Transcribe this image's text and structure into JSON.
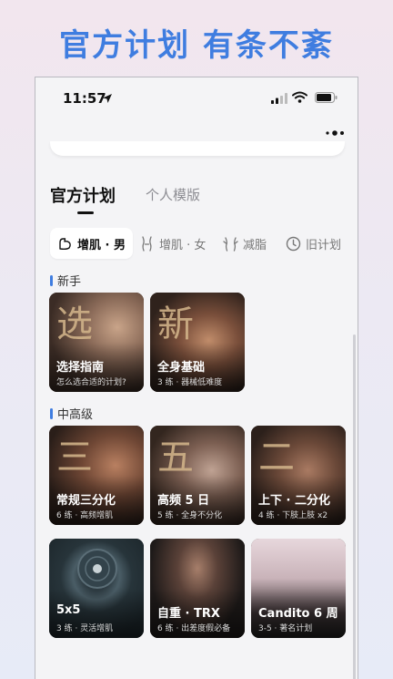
{
  "banner": {
    "title": "官方计划 有条不紊"
  },
  "status_bar": {
    "time": "11:57"
  },
  "tabs": {
    "active": "官方计划",
    "inactive": "个人模版"
  },
  "chips": [
    {
      "label": "增肌 · 男",
      "icon": "muscle-arm-icon"
    },
    {
      "label": "增肌 · 女",
      "icon": "female-body-icon"
    },
    {
      "label": "减脂",
      "icon": "slim-body-icon"
    },
    {
      "label": "旧计划",
      "icon": "clock-icon"
    }
  ],
  "sections": [
    {
      "label": "新手",
      "cards": [
        {
          "char": "选",
          "title": "选择指南",
          "subtitle": "怎么选合适的计划?"
        },
        {
          "char": "新",
          "title": "全身基础",
          "subtitle": "3 练 · 器械低难度"
        }
      ]
    },
    {
      "label": "中高级",
      "cards": [
        {
          "char": "三",
          "title": "常规三分化",
          "subtitle": "6 练 · 高频增肌"
        },
        {
          "char": "五",
          "title": "高频 5 日",
          "subtitle": "5 练 · 全身不分化"
        },
        {
          "char": "二",
          "title": "上下 · 二分化",
          "subtitle": "4 练 · 下肢上肢 x2"
        },
        {
          "char": "",
          "title": "5x5",
          "subtitle": "3 练 · 灵活增肌"
        },
        {
          "char": "",
          "title": "自重 · TRX",
          "subtitle": "6 练 · 出差度假必备"
        },
        {
          "char": "",
          "title": "Candito 6 周",
          "subtitle": "3-5 · 著名计划"
        }
      ]
    }
  ],
  "colors": {
    "accent": "#3f7de0",
    "card_gold": "#d2b48a"
  }
}
